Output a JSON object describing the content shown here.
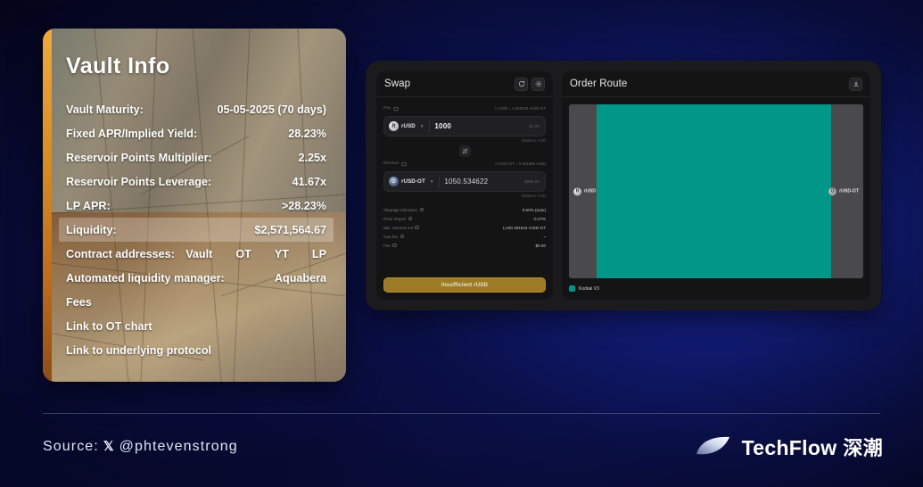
{
  "vault": {
    "title": "Vault Info",
    "rows": [
      {
        "label": "Vault Maturity:",
        "value": "05-05-2025 (70 days)",
        "highlight": false
      },
      {
        "label": "Fixed APR/Implied Yield:",
        "value": "28.23%",
        "highlight": false
      },
      {
        "label": "Reservoir Points Multiplier:",
        "value": "2.25x",
        "highlight": false
      },
      {
        "label": "Reservoir Points Leverage:",
        "value": "41.67x",
        "highlight": false
      },
      {
        "label": "LP APR:",
        "value": ">28.23%",
        "highlight": false
      },
      {
        "label": "Liquidity:",
        "value": "$2,571,564.67",
        "highlight": true
      }
    ],
    "contract_row": {
      "label": "Contract addresses:",
      "links": [
        "Vault",
        "OT",
        "YT",
        "LP"
      ]
    },
    "manager_row": {
      "label": "Automated liquidity manager:",
      "value": "Aquabera"
    },
    "plain_rows": [
      "Fees",
      "Link to OT chart",
      "Link to underlying protocol"
    ]
  },
  "swap": {
    "title": "Swap",
    "refresh_icon": "refresh-icon",
    "settings_icon": "gear-icon",
    "pay": {
      "meta_label": "Pay",
      "rate_text": "1 rUSD = 1.050534 rUSD-OT",
      "token": "rUSD",
      "token_symbol": "R",
      "amount": "1000",
      "usd_value": "$1.00",
      "balance_text": "Balance: 0.00"
    },
    "swap_direction_icon": "swap-vertical-icon",
    "receive": {
      "meta_label": "Receive",
      "rate_text": "1 rUSD-OT = 0.951896 rUSD",
      "token": "rUSD-OT",
      "token_symbol": "O",
      "amount": "1050.534622",
      "usd_value": "$995.61",
      "balance_text": "Balance: 0.00"
    },
    "details": [
      {
        "label": "Slippage tolerance",
        "value": "0.50% (auto)"
      },
      {
        "label": "Price impact",
        "value": "-0.47%"
      },
      {
        "label": "Min. amount out",
        "value": "1,040.281944 rUSD-OT"
      },
      {
        "label": "Gas fee",
        "value": "~"
      },
      {
        "label": "Fee",
        "value": "$0.00"
      }
    ],
    "cta_label": "Insufficient rUSD"
  },
  "order_route": {
    "title": "Order Route",
    "download_icon": "download-icon",
    "from_token": "rUSD",
    "from_symbol": "R",
    "to_token": "rUSD-OT",
    "to_symbol": "O",
    "route_color": "#009688",
    "legend": {
      "label": "Kodiak V3",
      "color": "#009688"
    }
  },
  "footer": {
    "source_prefix": "Source:",
    "x_glyph": "𝕏",
    "handle": "@phtevenstrong",
    "brand_en": "TechFlow",
    "brand_cn": "深潮"
  }
}
